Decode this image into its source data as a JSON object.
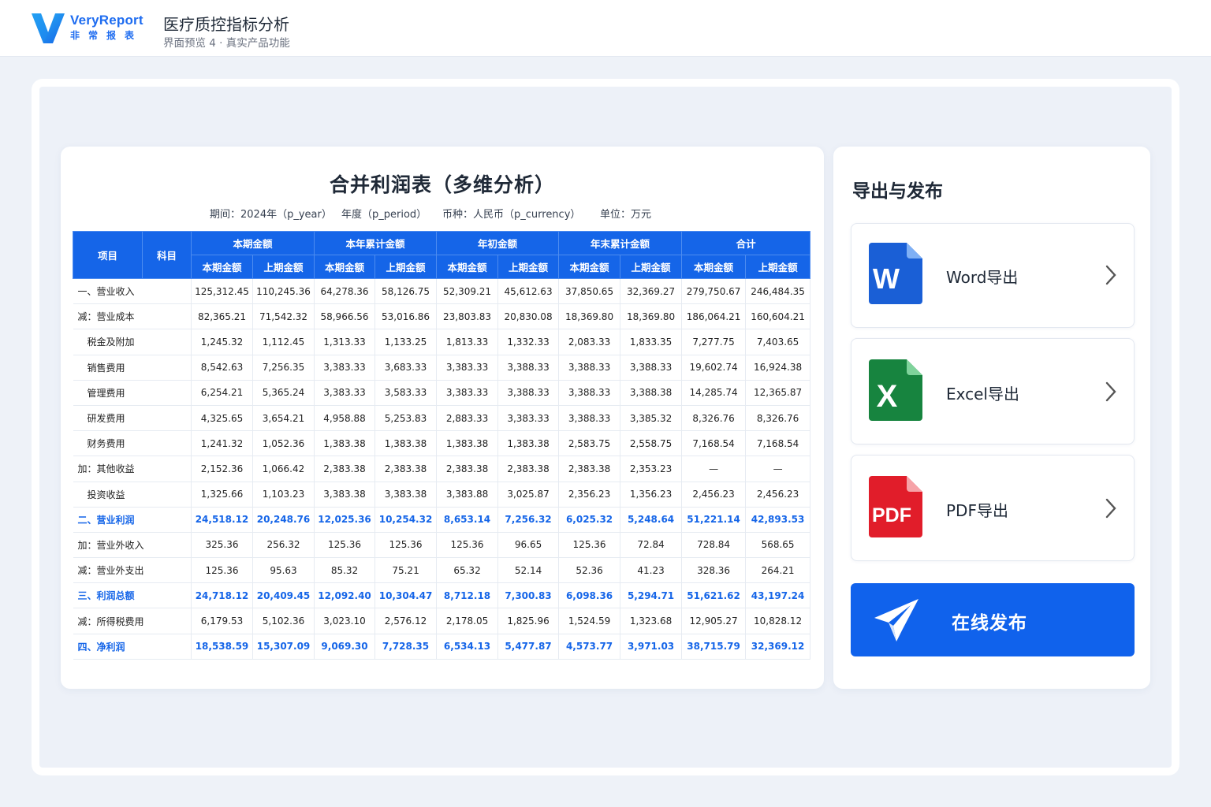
{
  "header": {
    "logo_name": "VeryReport",
    "logo_sub": "非常报表",
    "title": "医疗质控指标分析",
    "subtitle": "界面预览 4 · 真实产品功能"
  },
  "report": {
    "title": "合并利润表（多维分析）",
    "meta": {
      "period": "期间：2024年（p_year）",
      "year": "年度（p_period）",
      "currency": "币种：人民币（p_currency）",
      "unit": "单位：万元"
    },
    "header_top": {
      "item": "项目",
      "subject": "科目",
      "groups": [
        "本期金额",
        "本年累计金额",
        "年初金额",
        "年末累计金额",
        "合计"
      ]
    },
    "header_sub": [
      "本期金额",
      "上期金额",
      "本期金额",
      "上期金额",
      "本期金额",
      "上期金额",
      "本期金额",
      "上期金额",
      "本期金额",
      "上期金额"
    ],
    "rows": [
      {
        "label": "一、营业收入",
        "values": [
          "125,312.45",
          "110,245.36",
          "64,278.36",
          "58,126.75",
          "52,309.21",
          "45,612.63",
          "37,850.65",
          "32,369.27",
          "279,750.67",
          "246,484.35"
        ]
      },
      {
        "label": "减：营业成本",
        "values": [
          "82,365.21",
          "71,542.32",
          "58,966.56",
          "53,016.86",
          "23,803.83",
          "20,830.08",
          "18,369.80",
          "18,369.80",
          "186,064.21",
          "160,604.21"
        ]
      },
      {
        "label": "税金及附加",
        "values": [
          "1,245.32",
          "1,112.45",
          "1,313.33",
          "1,133.25",
          "1,813.33",
          "1,332.33",
          "2,083.33",
          "1,833.35",
          "7,277.75",
          "7,403.65"
        ]
      },
      {
        "label": "销售费用",
        "values": [
          "8,542.63",
          "7,256.35",
          "3,383.33",
          "3,683.33",
          "3,383.33",
          "3,388.33",
          "3,388.33",
          "3,388.33",
          "19,602.74",
          "16,924.38"
        ]
      },
      {
        "label": "管理费用",
        "values": [
          "6,254.21",
          "5,365.24",
          "3,383.33",
          "3,583.33",
          "3,383.33",
          "3,388.33",
          "3,388.33",
          "3,388.38",
          "14,285.74",
          "12,365.87"
        ]
      },
      {
        "label": "研发费用",
        "values": [
          "4,325.65",
          "3,654.21",
          "4,958.88",
          "5,253.83",
          "2,883.33",
          "3,383.33",
          "3,388.33",
          "3,385.32",
          "8,326.76",
          "8,326.76"
        ]
      },
      {
        "label": "财务费用",
        "values": [
          "1,241.32",
          "1,052.36",
          "1,383.38",
          "1,383.38",
          "1,383.38",
          "1,383.38",
          "2,583.75",
          "2,558.75",
          "7,168.54",
          "7,168.54"
        ]
      },
      {
        "label": "加：其他收益",
        "values": [
          "2,152.36",
          "1,066.42",
          "2,383.38",
          "2,383.38",
          "2,383.38",
          "2,383.38",
          "2,383.38",
          "2,353.23",
          "—",
          "—"
        ]
      },
      {
        "label": "投资收益",
        "values": [
          "1,325.66",
          "1,103.23",
          "3,383.38",
          "3,383.38",
          "3,383.88",
          "3,025.87",
          "2,356.23",
          "1,356.23",
          "2,456.23",
          "2,456.23"
        ]
      },
      {
        "label": "二、营业利润",
        "values": [
          "24,518.12",
          "20,248.76",
          "12,025.36",
          "10,254.32",
          "8,653.14",
          "7,256.32",
          "6,025.32",
          "5,248.64",
          "51,221.14",
          "42,893.53"
        ]
      },
      {
        "label": "加：营业外收入",
        "values": [
          "325.36",
          "256.32",
          "125.36",
          "125.36",
          "125.36",
          "96.65",
          "125.36",
          "72.84",
          "728.84",
          "568.65"
        ]
      },
      {
        "label": "减：营业外支出",
        "values": [
          "125.36",
          "95.63",
          "85.32",
          "75.21",
          "65.32",
          "52.14",
          "52.36",
          "41.23",
          "328.36",
          "264.21"
        ]
      },
      {
        "label": "三、利润总额",
        "values": [
          "24,718.12",
          "20,409.45",
          "12,092.40",
          "10,304.47",
          "8,712.18",
          "7,300.83",
          "6,098.36",
          "5,294.71",
          "51,621.62",
          "43,197.24"
        ]
      },
      {
        "label": "减：所得税费用",
        "values": [
          "6,179.53",
          "5,102.36",
          "3,023.10",
          "2,576.12",
          "2,178.05",
          "1,825.96",
          "1,524.59",
          "1,323.68",
          "12,905.27",
          "10,828.12"
        ]
      },
      {
        "label": "四、净利润",
        "values": [
          "18,538.59",
          "15,307.09",
          "9,069.30",
          "7,728.35",
          "6,534.13",
          "5,477.87",
          "4,573.77",
          "3,971.03",
          "38,715.79",
          "32,369.12"
        ]
      }
    ]
  },
  "export": {
    "title": "导出与发布",
    "word_label": "Word导出",
    "word_glyph": "W",
    "excel_label": "Excel导出",
    "excel_glyph": "X",
    "pdf_label": "PDF导出",
    "pdf_glyph": "PDF",
    "publish_label": "在线发布"
  },
  "colors": {
    "brand": "#1E6CF0",
    "table_header": "#1565E8",
    "highlight_text": "#1565E8",
    "word": "#1A5FD6",
    "excel": "#17843F",
    "pdf": "#E11D2A",
    "publish": "#1062EC"
  },
  "icons": [
    "logo-mark-icon",
    "word-file-icon",
    "excel-file-icon",
    "pdf-file-icon",
    "chevron-right-icon",
    "paper-plane-icon"
  ]
}
